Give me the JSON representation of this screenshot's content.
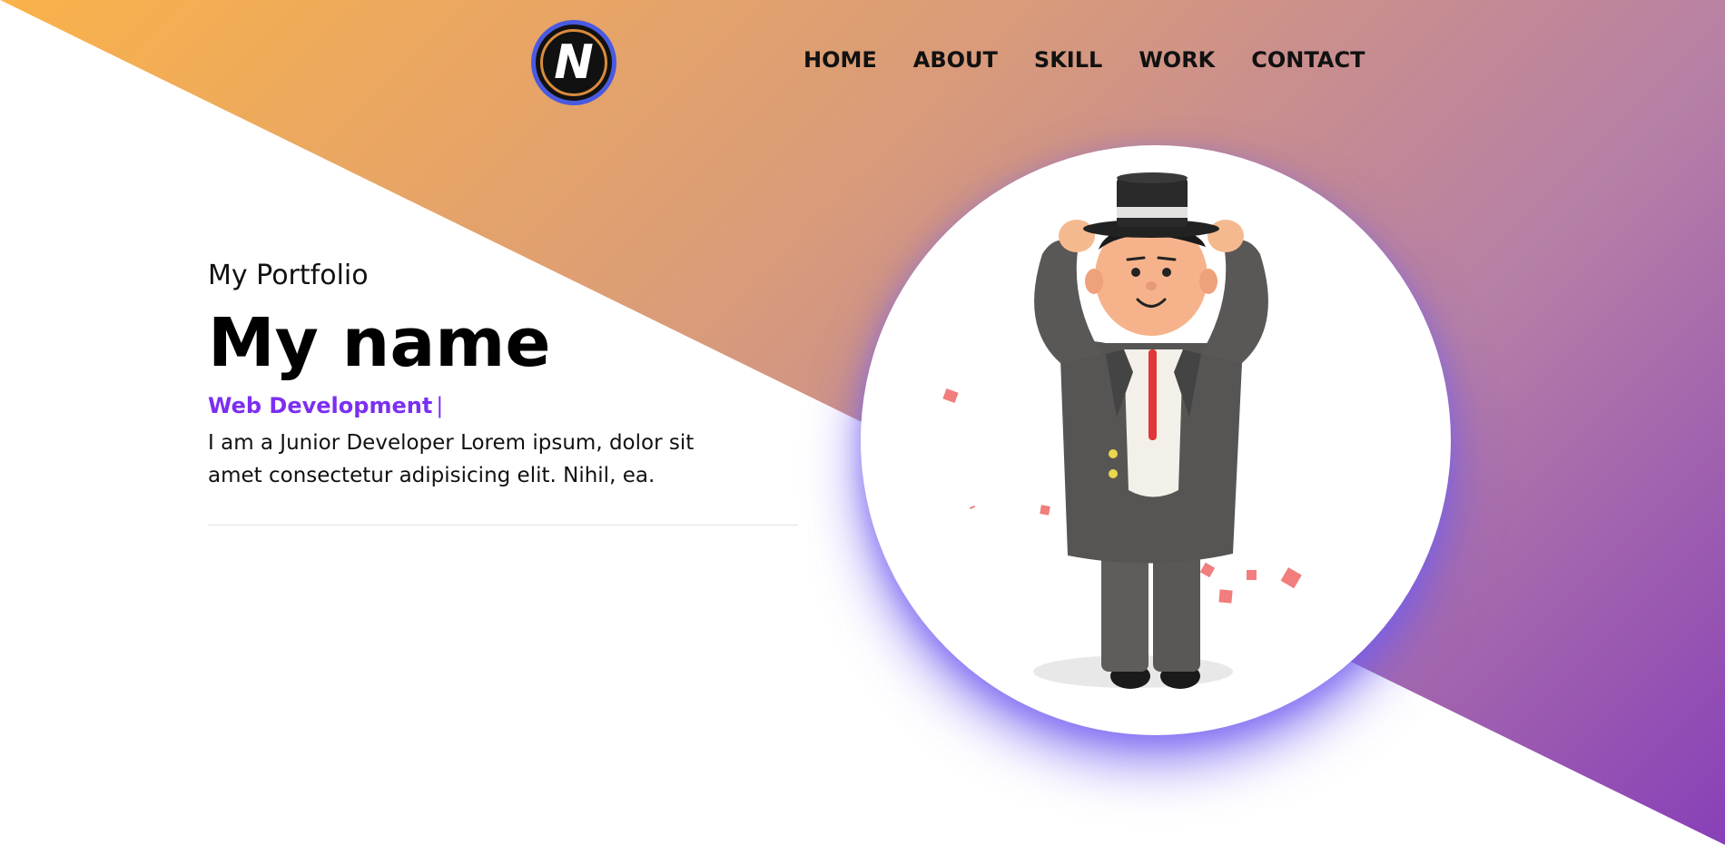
{
  "logo": {
    "letter": "N"
  },
  "nav": {
    "items": [
      "HOME",
      "ABOUT",
      "SKILL",
      "WORK",
      "CONTACT"
    ]
  },
  "hero": {
    "eyebrow": "My Portfolio",
    "name": "My name",
    "role": "Web Development",
    "cursor": "|",
    "description": "I am a Junior Developer Lorem ipsum, dolor sit amet consectetur adipisicing elit. Nihil, ea."
  },
  "colors": {
    "gradient_start": "#fab24a",
    "gradient_end": "#8840b8",
    "accent": "#7b2ff2",
    "glow": "#6e5af0"
  },
  "icons": {
    "logo": "n-letter-logo-icon",
    "avatar": "character-top-hat-illustration"
  }
}
